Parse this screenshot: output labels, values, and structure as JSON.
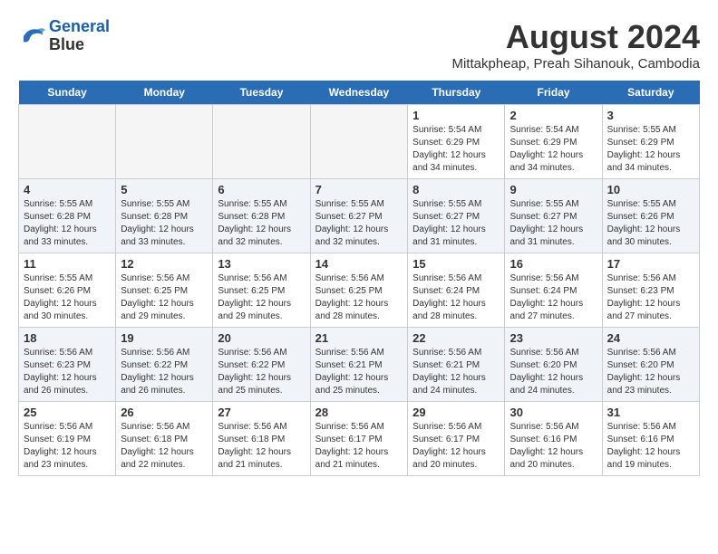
{
  "header": {
    "logo_line1": "General",
    "logo_line2": "Blue",
    "main_title": "August 2024",
    "subtitle": "Mittakpheap, Preah Sihanouk, Cambodia"
  },
  "weekdays": [
    "Sunday",
    "Monday",
    "Tuesday",
    "Wednesday",
    "Thursday",
    "Friday",
    "Saturday"
  ],
  "weeks": [
    [
      {
        "day": "",
        "info": ""
      },
      {
        "day": "",
        "info": ""
      },
      {
        "day": "",
        "info": ""
      },
      {
        "day": "",
        "info": ""
      },
      {
        "day": "1",
        "info": "Sunrise: 5:54 AM\nSunset: 6:29 PM\nDaylight: 12 hours\nand 34 minutes."
      },
      {
        "day": "2",
        "info": "Sunrise: 5:54 AM\nSunset: 6:29 PM\nDaylight: 12 hours\nand 34 minutes."
      },
      {
        "day": "3",
        "info": "Sunrise: 5:55 AM\nSunset: 6:29 PM\nDaylight: 12 hours\nand 34 minutes."
      }
    ],
    [
      {
        "day": "4",
        "info": "Sunrise: 5:55 AM\nSunset: 6:28 PM\nDaylight: 12 hours\nand 33 minutes."
      },
      {
        "day": "5",
        "info": "Sunrise: 5:55 AM\nSunset: 6:28 PM\nDaylight: 12 hours\nand 33 minutes."
      },
      {
        "day": "6",
        "info": "Sunrise: 5:55 AM\nSunset: 6:28 PM\nDaylight: 12 hours\nand 32 minutes."
      },
      {
        "day": "7",
        "info": "Sunrise: 5:55 AM\nSunset: 6:27 PM\nDaylight: 12 hours\nand 32 minutes."
      },
      {
        "day": "8",
        "info": "Sunrise: 5:55 AM\nSunset: 6:27 PM\nDaylight: 12 hours\nand 31 minutes."
      },
      {
        "day": "9",
        "info": "Sunrise: 5:55 AM\nSunset: 6:27 PM\nDaylight: 12 hours\nand 31 minutes."
      },
      {
        "day": "10",
        "info": "Sunrise: 5:55 AM\nSunset: 6:26 PM\nDaylight: 12 hours\nand 30 minutes."
      }
    ],
    [
      {
        "day": "11",
        "info": "Sunrise: 5:55 AM\nSunset: 6:26 PM\nDaylight: 12 hours\nand 30 minutes."
      },
      {
        "day": "12",
        "info": "Sunrise: 5:56 AM\nSunset: 6:25 PM\nDaylight: 12 hours\nand 29 minutes."
      },
      {
        "day": "13",
        "info": "Sunrise: 5:56 AM\nSunset: 6:25 PM\nDaylight: 12 hours\nand 29 minutes."
      },
      {
        "day": "14",
        "info": "Sunrise: 5:56 AM\nSunset: 6:25 PM\nDaylight: 12 hours\nand 28 minutes."
      },
      {
        "day": "15",
        "info": "Sunrise: 5:56 AM\nSunset: 6:24 PM\nDaylight: 12 hours\nand 28 minutes."
      },
      {
        "day": "16",
        "info": "Sunrise: 5:56 AM\nSunset: 6:24 PM\nDaylight: 12 hours\nand 27 minutes."
      },
      {
        "day": "17",
        "info": "Sunrise: 5:56 AM\nSunset: 6:23 PM\nDaylight: 12 hours\nand 27 minutes."
      }
    ],
    [
      {
        "day": "18",
        "info": "Sunrise: 5:56 AM\nSunset: 6:23 PM\nDaylight: 12 hours\nand 26 minutes."
      },
      {
        "day": "19",
        "info": "Sunrise: 5:56 AM\nSunset: 6:22 PM\nDaylight: 12 hours\nand 26 minutes."
      },
      {
        "day": "20",
        "info": "Sunrise: 5:56 AM\nSunset: 6:22 PM\nDaylight: 12 hours\nand 25 minutes."
      },
      {
        "day": "21",
        "info": "Sunrise: 5:56 AM\nSunset: 6:21 PM\nDaylight: 12 hours\nand 25 minutes."
      },
      {
        "day": "22",
        "info": "Sunrise: 5:56 AM\nSunset: 6:21 PM\nDaylight: 12 hours\nand 24 minutes."
      },
      {
        "day": "23",
        "info": "Sunrise: 5:56 AM\nSunset: 6:20 PM\nDaylight: 12 hours\nand 24 minutes."
      },
      {
        "day": "24",
        "info": "Sunrise: 5:56 AM\nSunset: 6:20 PM\nDaylight: 12 hours\nand 23 minutes."
      }
    ],
    [
      {
        "day": "25",
        "info": "Sunrise: 5:56 AM\nSunset: 6:19 PM\nDaylight: 12 hours\nand 23 minutes."
      },
      {
        "day": "26",
        "info": "Sunrise: 5:56 AM\nSunset: 6:18 PM\nDaylight: 12 hours\nand 22 minutes."
      },
      {
        "day": "27",
        "info": "Sunrise: 5:56 AM\nSunset: 6:18 PM\nDaylight: 12 hours\nand 21 minutes."
      },
      {
        "day": "28",
        "info": "Sunrise: 5:56 AM\nSunset: 6:17 PM\nDaylight: 12 hours\nand 21 minutes."
      },
      {
        "day": "29",
        "info": "Sunrise: 5:56 AM\nSunset: 6:17 PM\nDaylight: 12 hours\nand 20 minutes."
      },
      {
        "day": "30",
        "info": "Sunrise: 5:56 AM\nSunset: 6:16 PM\nDaylight: 12 hours\nand 20 minutes."
      },
      {
        "day": "31",
        "info": "Sunrise: 5:56 AM\nSunset: 6:16 PM\nDaylight: 12 hours\nand 19 minutes."
      }
    ]
  ]
}
